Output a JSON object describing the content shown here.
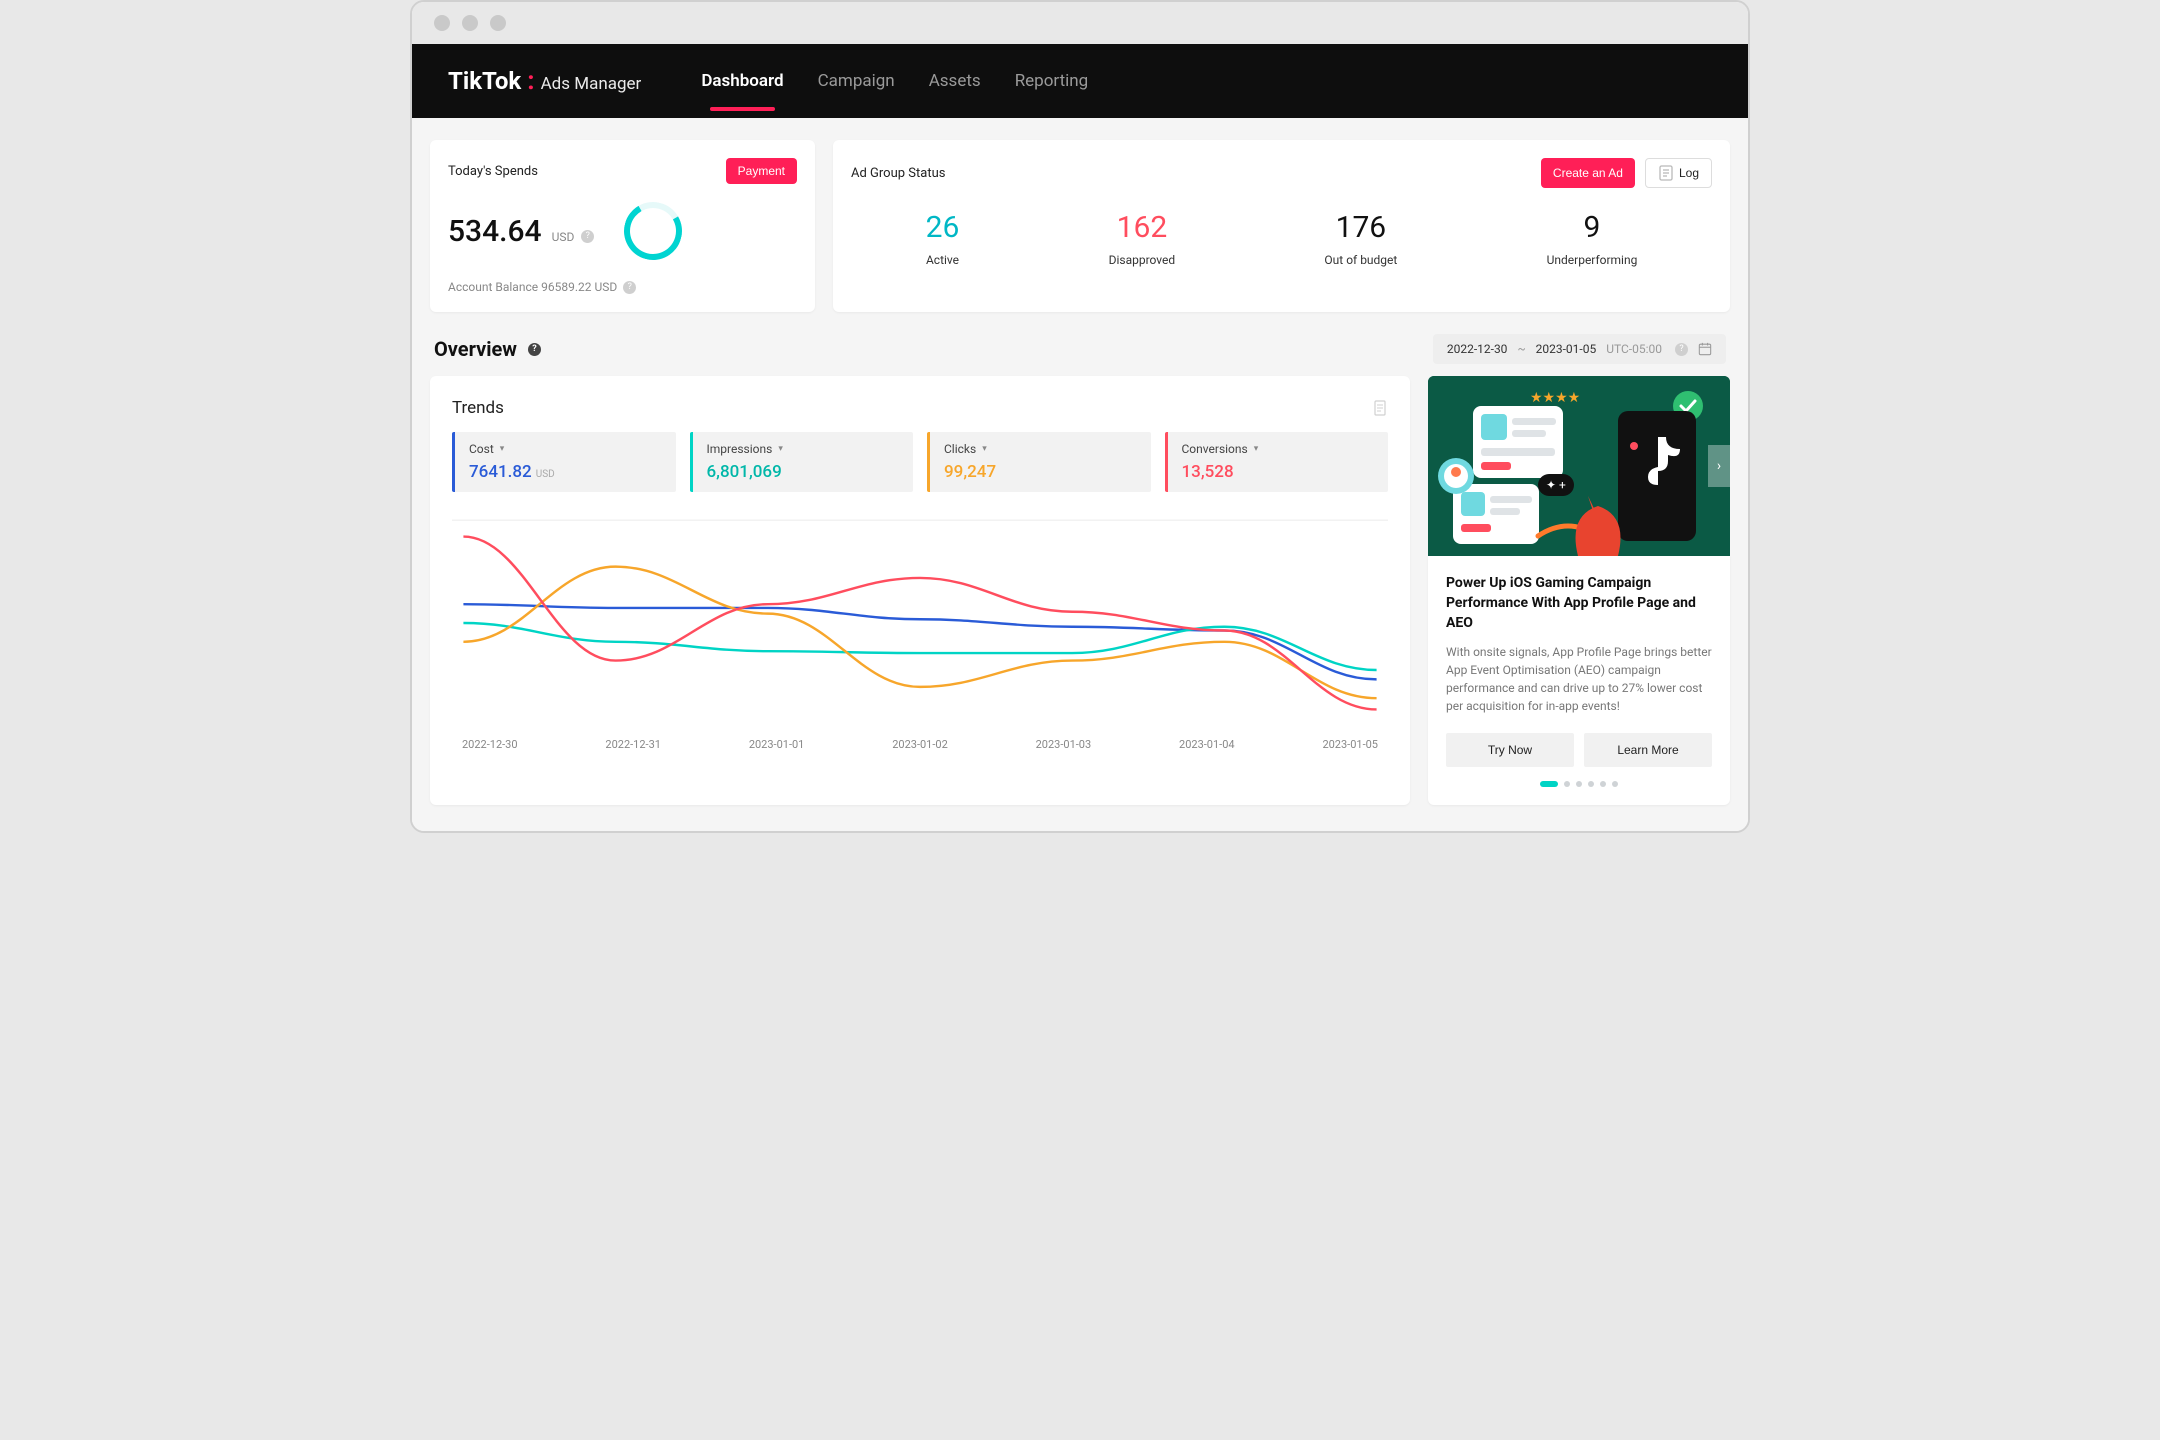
{
  "header": {
    "brand1": "TikTok",
    "brand2": "Ads Manager",
    "tabs": [
      "Dashboard",
      "Campaign",
      "Assets",
      "Reporting"
    ],
    "active_tab": 0
  },
  "spend": {
    "title": "Today's Spends",
    "payment_btn": "Payment",
    "amount": "534.64",
    "currency": "USD",
    "balance_prefix": "Account Balance",
    "balance_value": "96589.22 USD"
  },
  "status": {
    "title": "Ad Group Status",
    "create_btn": "Create an Ad",
    "log_btn": "Log",
    "items": [
      {
        "num": "26",
        "label": "Active",
        "cls": "c-teal"
      },
      {
        "num": "162",
        "label": "Disapproved",
        "cls": "c-red"
      },
      {
        "num": "176",
        "label": "Out of budget",
        "cls": "c-black"
      },
      {
        "num": "9",
        "label": "Underperforming",
        "cls": "c-black"
      }
    ]
  },
  "overview": {
    "title": "Overview",
    "date_from": "2022-12-30",
    "date_to": "2023-01-05",
    "tz": "UTC-05:00"
  },
  "trends": {
    "title": "Trends",
    "pills": [
      {
        "label": "Cost",
        "value": "7641.82",
        "sub": "USD",
        "cls": "p-blue"
      },
      {
        "label": "Impressions",
        "value": "6,801,069",
        "sub": "",
        "cls": "p-teal"
      },
      {
        "label": "Clicks",
        "value": "99,247",
        "sub": "",
        "cls": "p-orange"
      },
      {
        "label": "Conversions",
        "value": "13,528",
        "sub": "",
        "cls": "p-pink"
      }
    ],
    "x_labels": [
      "2022-12-30",
      "2022-12-31",
      "2023-01-01",
      "2023-01-02",
      "2023-01-03",
      "2023-01-04",
      "2023-01-05"
    ]
  },
  "promo": {
    "title": "Power Up iOS Gaming Campaign Performance With App Profile Page and AEO",
    "text": "With onsite signals, App Profile Page brings better App Event Optimisation (AEO) campaign performance and can drive up to 27% lower cost per acquisition for in-app events!",
    "btn1": "Try Now",
    "btn2": "Learn More"
  },
  "chart_data": {
    "type": "line",
    "title": "Trends",
    "xlabel": "",
    "ylabel": "",
    "x": [
      "2022-12-30",
      "2022-12-31",
      "2023-01-01",
      "2023-01-02",
      "2023-01-03",
      "2023-01-04",
      "2023-01-05"
    ],
    "series": [
      {
        "name": "Cost",
        "color": "#2a5bd7",
        "values_relative": [
          60,
          58,
          58,
          52,
          48,
          46,
          20
        ]
      },
      {
        "name": "Impressions",
        "color": "#00d4c5",
        "values_relative": [
          50,
          40,
          35,
          34,
          34,
          48,
          25
        ]
      },
      {
        "name": "Clicks",
        "color": "#f7a62b",
        "values_relative": [
          40,
          80,
          55,
          16,
          30,
          40,
          10
        ]
      },
      {
        "name": "Conversions",
        "color": "#ff4d5e",
        "values_relative": [
          96,
          30,
          60,
          74,
          56,
          46,
          4
        ]
      }
    ],
    "note": "values_relative are 0-100 vertical positions inferred from the untitled y-axis; absolute units not shown in source"
  }
}
